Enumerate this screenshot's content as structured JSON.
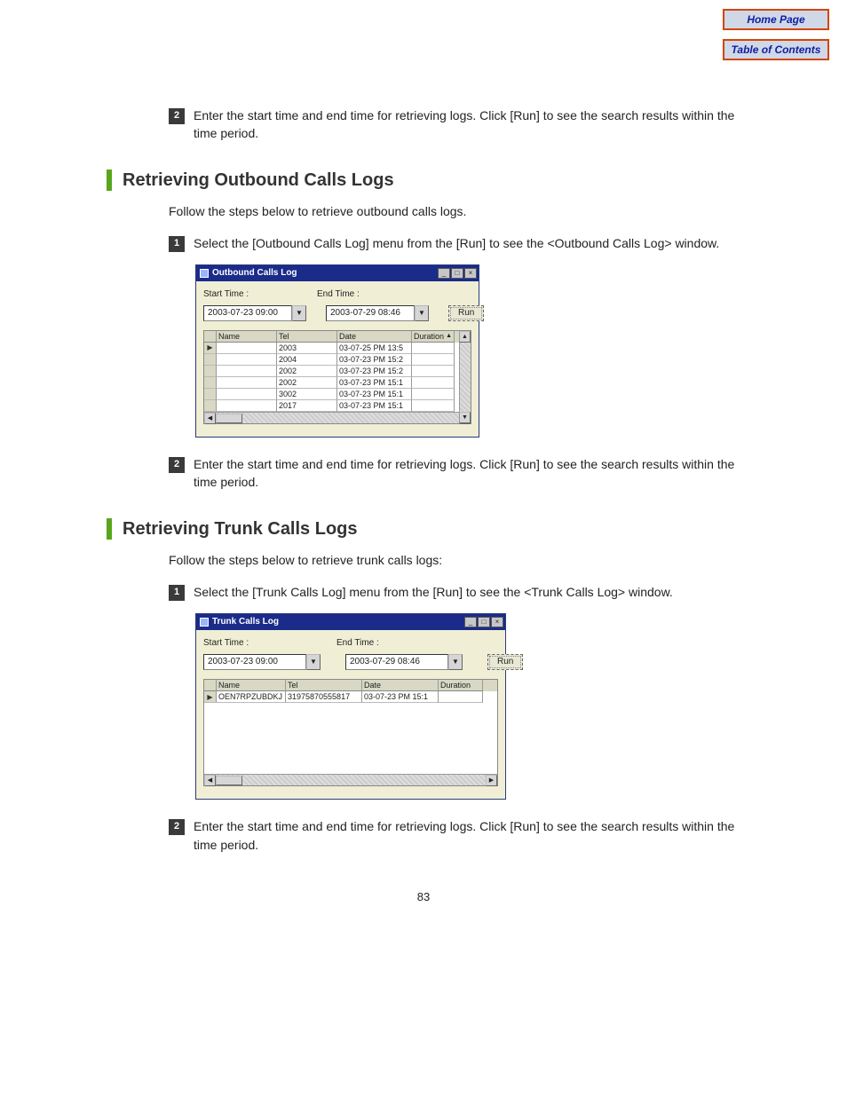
{
  "nav": {
    "home": "Home Page",
    "toc": "Table of Contents"
  },
  "page_number": "83",
  "intro_step": {
    "num": "2",
    "text": "Enter the start time and end time for retrieving logs. Click [Run] to see the search results within the time period."
  },
  "outbound": {
    "heading": "Retrieving Outbound Calls Logs",
    "intro": "Follow the steps below to retrieve outbound calls logs.",
    "step1": {
      "num": "1",
      "text": "Select the [Outbound Calls Log] menu from the [Run] to see the <Outbound Calls Log> window."
    },
    "step2": {
      "num": "2",
      "text": "Enter the start time and end time for retrieving logs. Click [Run] to see the search results within the time period."
    },
    "window": {
      "title": "Outbound Calls Log",
      "start_label": "Start Time :",
      "end_label": "End Time :",
      "start_value": "2003-07-23 09:00",
      "end_value": "2003-07-29 08:46",
      "run": "Run",
      "cols": {
        "name": "Name",
        "tel": "Tel",
        "date": "Date",
        "dur": "Duration"
      },
      "rows": [
        {
          "name": "",
          "tel": "2003",
          "date": "03-07-25 PM 13:5",
          "dur": ""
        },
        {
          "name": "",
          "tel": "2004",
          "date": "03-07-23 PM 15:2",
          "dur": ""
        },
        {
          "name": "",
          "tel": "2002",
          "date": "03-07-23 PM 15:2",
          "dur": ""
        },
        {
          "name": "",
          "tel": "2002",
          "date": "03-07-23 PM 15:1",
          "dur": ""
        },
        {
          "name": "",
          "tel": "3002",
          "date": "03-07-23 PM 15:1",
          "dur": ""
        },
        {
          "name": "",
          "tel": "2017",
          "date": "03-07-23 PM 15:1",
          "dur": ""
        }
      ]
    }
  },
  "trunk": {
    "heading": "Retrieving Trunk Calls Logs",
    "intro": "Follow the steps below to retrieve trunk calls logs:",
    "step1": {
      "num": "1",
      "text": "Select the [Trunk Calls Log] menu from the [Run] to see the <Trunk Calls Log> window."
    },
    "step2": {
      "num": "2",
      "text": "Enter the start time and end time for retrieving logs. Click [Run] to see the search results within the time period."
    },
    "window": {
      "title": "Trunk Calls Log",
      "start_label": "Start Time :",
      "end_label": "End Time :",
      "start_value": "2003-07-23 09:00",
      "end_value": "2003-07-29 08:46",
      "run": "Run",
      "cols": {
        "name": "Name",
        "tel": "Tel",
        "date": "Date",
        "dur": "Duration"
      },
      "row": {
        "name": "OEN7RPZUBDKJ",
        "tel": "31975870555817",
        "date": "03-07-23 PM 15:1",
        "dur": ""
      }
    }
  }
}
